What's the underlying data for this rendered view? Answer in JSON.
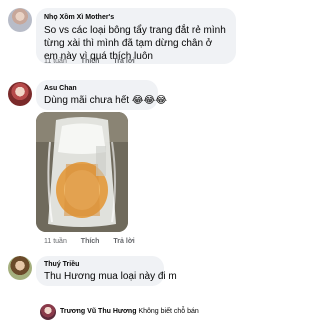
{
  "comments": [
    {
      "author": "Nhọ Xồm Xì Mother's",
      "text": "So vs các loại bông tẩy trang đắt rẻ mình từng xài thì mình đã tạm dừng chân ở em này vì quá thích luôn",
      "time": "11 tuần",
      "like_label": "Thích",
      "reply_label": "Trả lời"
    },
    {
      "author": "Asu Chan",
      "text": "Dùng mãi chưa hết 😂😂😂",
      "time": "11 tuần",
      "like_label": "Thích",
      "reply_label": "Trả lời"
    },
    {
      "author": "Thuý Triều",
      "text": "Thu Hương mua loại này đi m"
    }
  ],
  "reply_preview": {
    "name": "Trương Vũ Thu Hương",
    "text": "Không biết chỗ bán"
  },
  "colors": {
    "bubble": "#f0f2f5",
    "meta_text": "#65676b",
    "text": "#050505"
  }
}
